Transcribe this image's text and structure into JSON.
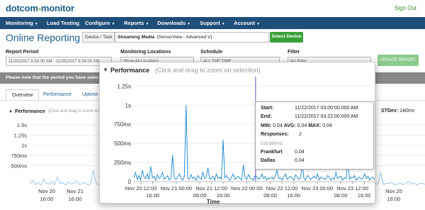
{
  "header": {
    "logo_main": "dotcom",
    "logo_dash": "-",
    "logo_end": "monitor",
    "sign_out": "Sign Out"
  },
  "nav": {
    "items": [
      {
        "label": "Monitoring"
      },
      {
        "label": "Load Testing"
      },
      {
        "label": "Configure"
      },
      {
        "label": "Reports"
      },
      {
        "label": "Downloads"
      },
      {
        "label": "Support"
      },
      {
        "label": "Account"
      }
    ]
  },
  "page": {
    "title": "Online Reporting",
    "device_task_label": "Device / Task",
    "device_name": "Streaming Media",
    "device_detail": "(ServerView - Advanced V)",
    "select_device": "Select Device"
  },
  "filters": {
    "report_period_label": "Report Period",
    "report_period_value": "11/20/2017 9:34:00 AM - 11/25/2017 9:34:00 AM",
    "monitoring_locations_label": "Monitoring Locations",
    "monitoring_locations_value": "Show All Locations",
    "schedule_label": "Schedule",
    "schedule_value": "ALL THE TIME",
    "filter_label": "Filter",
    "filter_value": "No Filter",
    "update_report": "UPDATE REPORT"
  },
  "notice": "Please note that the period you have selec",
  "tabs": [
    {
      "label": "Overview",
      "active": true
    },
    {
      "label": "Performance",
      "active": false
    },
    {
      "label": "Uptime",
      "active": false
    }
  ],
  "background_panel": {
    "title": "Performance",
    "subtitle": "(Click and drag to zoom on selection)",
    "stdev_label": "STDev:",
    "stdev_value": "140ms",
    "y_ticks": [
      "1.5s",
      "1.25s",
      "1s",
      "750ms",
      "500ms"
    ],
    "x_ticks": [
      "Nov 20",
      "16:00",
      "Nov 21",
      "16:00",
      "Nov 25",
      "16:00"
    ]
  },
  "popup": {
    "title": "Performance",
    "subtitle": "(Click and drag to zoom on selection)",
    "x_label": "Time"
  },
  "tooltip": {
    "start_label": "Start:",
    "start_value": "11/22/2017 03:00:00.000 AM",
    "end_label": "End:",
    "end_value": "11/22/2017 03:22:00.000 AM",
    "stats": "MIN: 0.04  AVG: 0.04  MAX: 0.04",
    "min_label": "MIN:",
    "min_value": "0.04",
    "avg_label": "AVG:",
    "avg_value": "0.04",
    "max_label": "MAX:",
    "max_value": "0.04",
    "responses_label": "Responses:",
    "responses_value": "2",
    "locations_label": "Locations:",
    "locations": [
      {
        "name": "Frankfurt",
        "value": "0.04"
      },
      {
        "name": "Dallas",
        "value": "0.04"
      }
    ]
  },
  "colors": {
    "nav_bg": "#1f4e79",
    "brand_blue": "#1d5f8a",
    "series": "#2b8fd6",
    "select_green": "#3aa03a"
  },
  "chart_data": {
    "type": "line",
    "title": "Performance",
    "xlabel": "Time",
    "ylabel": "",
    "y_ticks": [
      "0",
      "250ms",
      "500ms",
      "750ms",
      "1s",
      "1.25s"
    ],
    "y_tick_values": [
      0,
      0.25,
      0.5,
      0.75,
      1.0,
      1.25
    ],
    "ylim": [
      0,
      1.3
    ],
    "x_ticks": [
      {
        "top": "Nov 20 12:00",
        "bottom": "",
        "hour": 2.43
      },
      {
        "top": "",
        "bottom": "16:00",
        "hour": 6.43
      },
      {
        "top": "Nov 21 00:00",
        "bottom": "",
        "hour": 14.43
      },
      {
        "top": "",
        "bottom": "08:00",
        "hour": 22.43
      },
      {
        "top": "Nov 21 12:00",
        "bottom": "",
        "hour": 26.43
      },
      {
        "top": "",
        "bottom": "16:00",
        "hour": 30.43
      },
      {
        "top": "Nov 22 00:00",
        "bottom": "",
        "hour": 38.43
      },
      {
        "top": "",
        "bottom": "08:00",
        "hour": 46.43
      },
      {
        "top": "Nov 22 12:00",
        "bottom": "",
        "hour": 50.43
      },
      {
        "top": "",
        "bottom": "16:00",
        "hour": 54.43
      },
      {
        "top": "Nov 23 00:00",
        "bottom": "",
        "hour": 62.43
      },
      {
        "top": "",
        "bottom": "08:00",
        "hour": 70.43
      },
      {
        "top": "Nov 23 12:00",
        "bottom": "",
        "hour": 74.43
      },
      {
        "top": "",
        "bottom": "16:00",
        "hour": 78.43
      }
    ],
    "xlim_hours": [
      0,
      82
    ],
    "selection_hour": 41.43,
    "series": [
      {
        "values": [
          0.05,
          0.12,
          0.03,
          0.08,
          0.02,
          0.15,
          0.06,
          0.04,
          0.1,
          0.03,
          0.2,
          0.05,
          0.07,
          0.02,
          0.09,
          0.04,
          0.06,
          0.12,
          0.03,
          0.05,
          0.08,
          0.02,
          0.04,
          0.35,
          0.05,
          0.03,
          0.06,
          0.1,
          0.04,
          0.02,
          0.07,
          1.0,
          0.05,
          0.03,
          0.09,
          0.04,
          0.06,
          0.02,
          0.08,
          0.05,
          0.03,
          0.12,
          0.04,
          0.06,
          0.18,
          0.03,
          0.05,
          0.07,
          0.02,
          0.1,
          0.04,
          0.06,
          0.03,
          0.55,
          0.05,
          0.08,
          0.04,
          0.02,
          0.06,
          0.1,
          0.03,
          0.05,
          0.07,
          0.04,
          0.02,
          0.22,
          0.06,
          0.03,
          0.09,
          0.05,
          0.04,
          0.02,
          0.08,
          0.06,
          0.03,
          0.05,
          0.1,
          0.04,
          0.07,
          0.02,
          0.05,
          0.04,
          0.06,
          0.03,
          0.08,
          0.15,
          0.04,
          0.05,
          0.02,
          0.06,
          0.1,
          0.03,
          0.05,
          0.07,
          0.04,
          0.02,
          0.09,
          0.06,
          0.03,
          0.05,
          0.25,
          0.04,
          0.02,
          0.08,
          0.06,
          0.03,
          0.05,
          0.07,
          0.04,
          0.1,
          0.02,
          0.06,
          0.05,
          0.03,
          0.04,
          0.08,
          0.06,
          0.02,
          0.05,
          0.03,
          0.12,
          0.04,
          0.06,
          0.07,
          0.02,
          0.05,
          0.04,
          0.3,
          0.03,
          0.06,
          0.05,
          0.08,
          0.02,
          0.04,
          0.06,
          0.03,
          0.05,
          0.1,
          0.04,
          0.07,
          0.02,
          0.05,
          0.06,
          0.03
        ]
      }
    ]
  }
}
